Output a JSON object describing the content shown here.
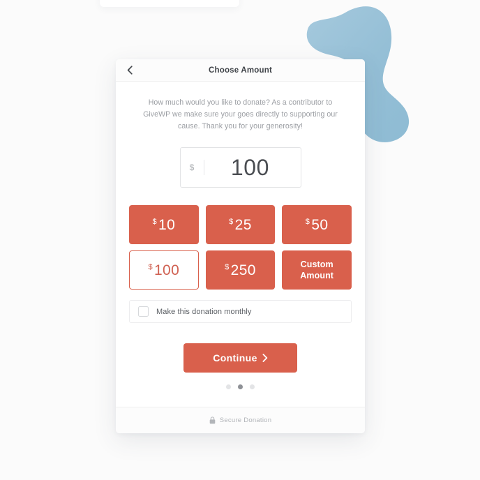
{
  "theme": {
    "accent": "#d9604c",
    "accent_text": "#d06152",
    "page_background": "#fbfbfb",
    "card_background": "#ffffff",
    "blob_color": "#9cc4da",
    "muted_text": "#9b9ea3"
  },
  "header": {
    "title": "Choose Amount",
    "back_icon": "chevron-left-icon"
  },
  "body": {
    "description": "How much would you like to donate? As a contributor to GiveWP we make sure your goes directly to supporting our cause. Thank you for your generosity!"
  },
  "amount_input": {
    "currency_symbol": "$",
    "value": "100",
    "placeholder": "0"
  },
  "amount_options": [
    {
      "currency": "$",
      "amount": "10",
      "label": "$10",
      "selected": false,
      "type": "preset"
    },
    {
      "currency": "$",
      "amount": "25",
      "label": "$25",
      "selected": false,
      "type": "preset"
    },
    {
      "currency": "$",
      "amount": "50",
      "label": "$50",
      "selected": false,
      "type": "preset"
    },
    {
      "currency": "$",
      "amount": "100",
      "label": "$100",
      "selected": true,
      "type": "preset"
    },
    {
      "currency": "$",
      "amount": "250",
      "label": "$250",
      "selected": false,
      "type": "preset"
    },
    {
      "line1": "Custom",
      "line2": "Amount",
      "label": "Custom Amount",
      "selected": false,
      "type": "custom"
    }
  ],
  "recurring": {
    "label": "Make this donation monthly",
    "checked": false,
    "checkbox_icon": "checkbox-unchecked-icon"
  },
  "continue": {
    "label": "Continue",
    "arrow_icon": "chevron-right-icon"
  },
  "pagination": {
    "total": 3,
    "active_index": 1
  },
  "footer": {
    "lock_icon": "lock-icon",
    "label": "Secure Donation"
  }
}
